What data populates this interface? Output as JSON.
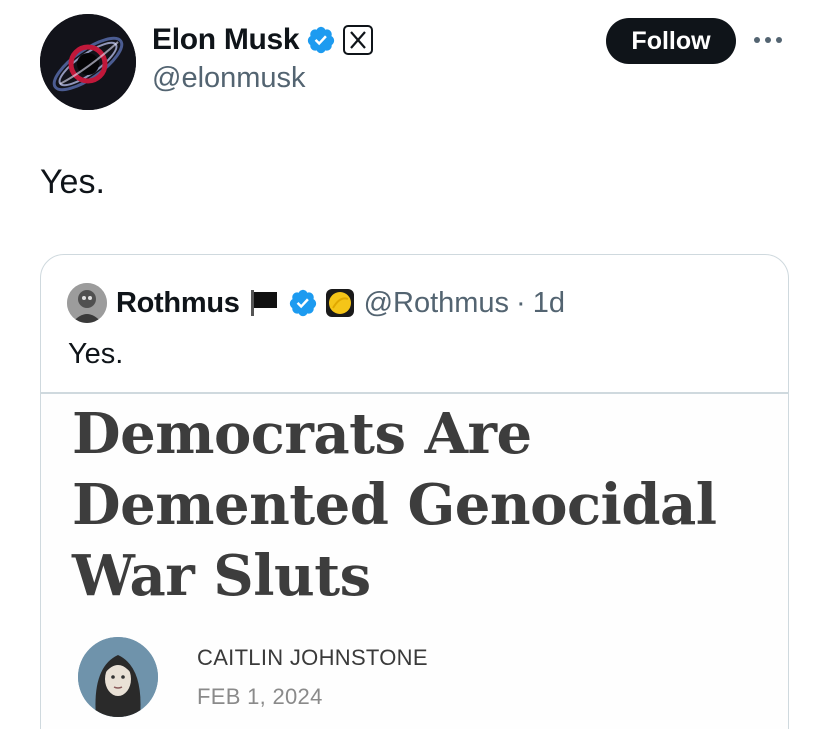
{
  "author": {
    "display_name": "Elon Musk",
    "handle": "@elonmusk",
    "avatar_icon": "black-hole-avatar-icon",
    "verified_icon": "verified-badge-icon",
    "affiliation_icon": "x-logo-badge-icon"
  },
  "actions": {
    "follow_label": "Follow",
    "more_icon": "more-options-icon"
  },
  "tweet": {
    "text": "Yes."
  },
  "quoted_tweet": {
    "display_name": "Rothmus",
    "handle": "@Rothmus",
    "separator": "·",
    "time": "1d",
    "text": "Yes.",
    "icons": [
      "black-flag-icon",
      "verified-badge-icon",
      "yellow-circle-badge-icon"
    ]
  },
  "article_card": {
    "headline": "Democrats Are Demented Genocidal War Sluts",
    "author_name": "CAITLIN JOHNSTONE",
    "date": "FEB 1, 2024"
  },
  "colors": {
    "text_primary": "#0f1419",
    "text_secondary": "#536471",
    "verified_blue": "#1d9bf0",
    "border": "#cfd9de",
    "headline": "#3d3d3d"
  }
}
